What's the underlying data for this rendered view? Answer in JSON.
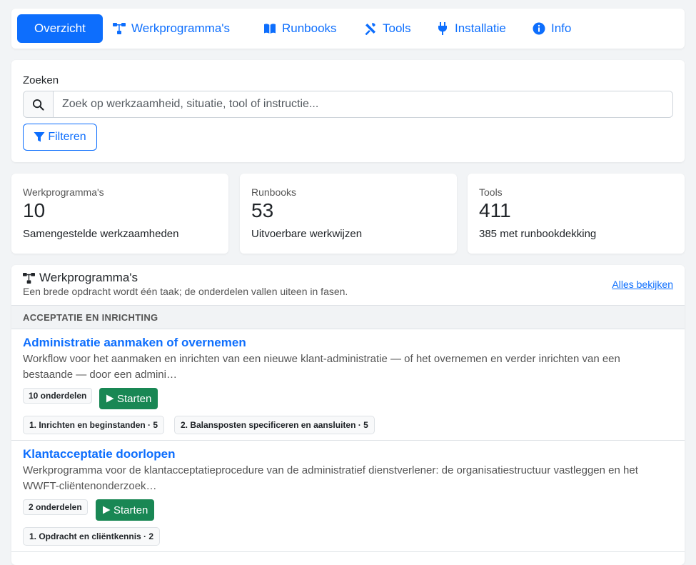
{
  "nav": {
    "items": [
      {
        "label": "Overzicht",
        "icon": "home",
        "active": true
      },
      {
        "label": "Werkprogramma's",
        "icon": "sitemap-icon"
      },
      {
        "label": "Runbooks",
        "icon": "book-icon"
      },
      {
        "label": "Tools",
        "icon": "tools-icon"
      },
      {
        "label": "Installatie",
        "icon": "plug-icon"
      },
      {
        "label": "Info",
        "icon": "info-icon"
      }
    ]
  },
  "search": {
    "label": "Zoeken",
    "placeholder": "Zoek op werkzaamheid, situatie, tool of instructie...",
    "value": "",
    "filter_label": "Filteren"
  },
  "stats": [
    {
      "title": "Werkprogramma's",
      "value": "10",
      "sub": "Samengestelde werkzaamheden"
    },
    {
      "title": "Runbooks",
      "value": "53",
      "sub": "Uitvoerbare werkwijzen"
    },
    {
      "title": "Tools",
      "value": "411",
      "sub": "385 met runbookdekking"
    }
  ],
  "workprograms": {
    "title": "Werkprogramma's",
    "subtitle": "Een brede opdracht wordt één taak; de onderdelen vallen uiteen in fasen.",
    "link": "Alles bekijken",
    "section": "ACCEPTATIE EN INRICHTING",
    "start_label": "Starten",
    "items": [
      {
        "title": "Administratie aanmaken of overnemen",
        "description": "Workflow voor het aanmaken en inrichten van een nieuwe klant-administratie — of het overnemen en verder inrichten van een bestaande — door een admini…",
        "parts": "10 onderdelen",
        "phases": [
          "1. Inrichten en beginstanden · 5",
          "2. Balansposten specificeren en aansluiten · 5"
        ]
      },
      {
        "title": "Klantacceptatie doorlopen",
        "description": "Werkprogramma voor de klantacceptatieprocedure van de administratief dienstverlener: de organisatiestructuur vastleggen en het WWFT-cliëntenonderzoek…",
        "parts": "2 onderdelen",
        "phases": [
          "1. Opdracht en cliëntkennis · 2"
        ]
      }
    ]
  }
}
